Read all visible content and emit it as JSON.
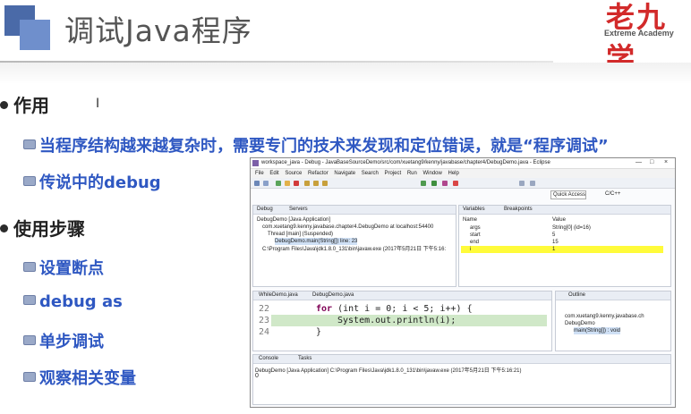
{
  "slide": {
    "title": "调试Java程序",
    "logo": {
      "main": "老九学",
      "sub": "Extreme Academy"
    },
    "bullets": [
      {
        "text": "作用",
        "children": [
          "当程序结构越来越复杂时，需要专门的技术来发现和定位错误，就是“程序调试”",
          "传说中的debug"
        ]
      },
      {
        "text": "使用步骤",
        "children": [
          "设置断点",
          "debug as",
          "单步调试",
          "观察相关变量"
        ]
      }
    ],
    "cursor": "I"
  },
  "eclipse": {
    "window_title": "workspace_java - Debug - JavaBaseSourceDemo/src/com/xuetang9/kenny/javabase/chapter4/DebugDemo.java - Eclipse",
    "window_buttons": [
      "—",
      "□",
      "×"
    ],
    "menu": [
      "File",
      "Edit",
      "Source",
      "Refactor",
      "Navigate",
      "Search",
      "Project",
      "Run",
      "Window",
      "Help"
    ],
    "quick_access": "Quick Access",
    "perspective": "C/C++",
    "debug_tabs": [
      "Debug",
      "Servers"
    ],
    "debug_tree": [
      "DebugDemo [Java Application]",
      "com.xuetang9.kenny.javabase.chapter4.DebugDemo at localhost:54400",
      "Thread [main] (Suspended)",
      "DebugDemo.main(String[]) line: 23",
      "C:\\Program Files\\Java\\jdk1.8.0_131\\bin\\javaw.exe (2017年5月21日 下午5:16:"
    ],
    "var_tabs": [
      "Variables",
      "Breakpoints"
    ],
    "var_headers": [
      "Name",
      "Value"
    ],
    "variables": [
      {
        "name": "args",
        "value": "String[0]  (id=16)"
      },
      {
        "name": "start",
        "value": "5"
      },
      {
        "name": "end",
        "value": "15"
      },
      {
        "name": "i",
        "value": "1"
      }
    ],
    "editor_tabs": [
      "WhileDemo.java",
      "DebugDemo.java"
    ],
    "code_lines": [
      {
        "num": "22",
        "kw": "for",
        "text": " (int i = 0; i < 5; i++) {"
      },
      {
        "num": "23",
        "text": "System.out.println(i);"
      },
      {
        "num": "24",
        "text": "}"
      }
    ],
    "outline_tab": "Outline",
    "outline": [
      "com.xuetang9.kenny.javabase.ch",
      "DebugDemo",
      "main(String[]) : void"
    ],
    "console_tabs": [
      "Console",
      "Tasks"
    ],
    "console_header": "DebugDemo [Java Application] C:\\Program Files\\Java\\jdk1.8.0_131\\bin\\javaw.exe (2017年5月21日 下午5:16:21)",
    "console_output": "0"
  }
}
